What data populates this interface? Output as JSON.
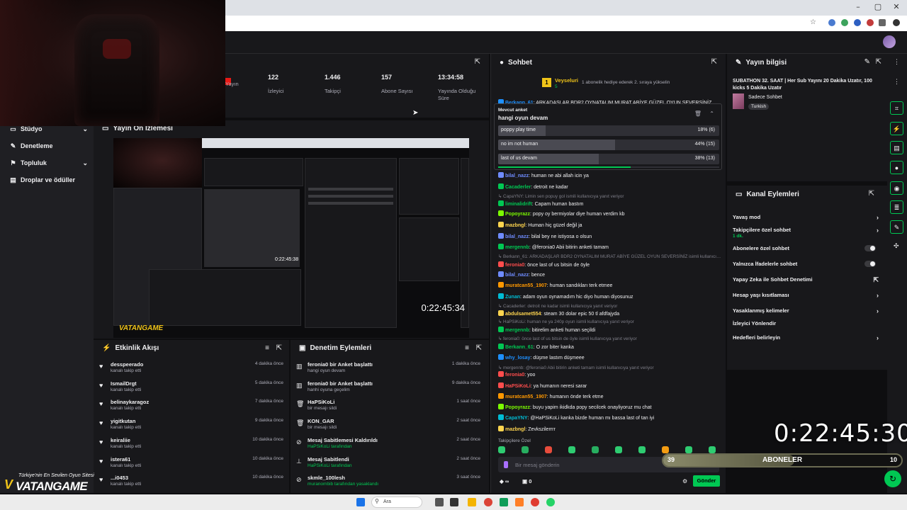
{
  "stats": [
    {
      "value": "",
      "label": "Yayın"
    },
    {
      "value": "122",
      "label": "İzleyici"
    },
    {
      "value": "1.446",
      "label": "Takipçi"
    },
    {
      "value": "157",
      "label": "Abone Sayısı"
    },
    {
      "value": "13:34:58",
      "label": "Yayında Olduğu Süre"
    }
  ],
  "nav": [
    {
      "label": "Stüdyo",
      "icon": "video-icon",
      "chev": "⌄"
    },
    {
      "label": "Denetleme",
      "icon": "wrench-icon",
      "chev": ""
    },
    {
      "label": "Topluluk",
      "icon": "group-icon",
      "chev": "⌄"
    },
    {
      "label": "Droplar ve ödüller",
      "icon": "gift-icon",
      "chev": ""
    }
  ],
  "preview": {
    "title": "Yayın Ön İzlemesi",
    "timer": "0:22:45:34",
    "small_timer": "0:22:45:38",
    "watermark": "VATANGAME"
  },
  "activity": {
    "title": "Etkinlik Akışı",
    "items": [
      {
        "name": "desspeerado",
        "sub": "kanalı takip etti",
        "time": "4 dakika önce"
      },
      {
        "name": "IsmailDrgt",
        "sub": "kanalı takip etti",
        "time": "5 dakika önce"
      },
      {
        "name": "belinaykaragoz",
        "sub": "kanalı takip etti",
        "time": "7 dakika önce"
      },
      {
        "name": "yigitkutan",
        "sub": "kanalı takip etti",
        "time": "9 dakika önce"
      },
      {
        "name": "keiraliie",
        "sub": "kanalı takip etti",
        "time": "10 dakika önce"
      },
      {
        "name": "istera61",
        "sub": "kanalı takip etti",
        "time": "10 dakika önce"
      },
      {
        "name": "...i0453",
        "sub": "kanalı takip etti",
        "time": "10 dakika önce"
      }
    ]
  },
  "modactions": {
    "title": "Denetim Eylemleri",
    "items": [
      {
        "name": "feronia0 bir Anket başlattı",
        "sub": "hangi oyun devam",
        "time": "1 dakika önce",
        "icon": "poll-icon"
      },
      {
        "name": "feronia0 bir Anket başlattı",
        "sub": "hanhi oyuna geçelim",
        "time": "9 dakika önce",
        "icon": "poll-icon"
      },
      {
        "name": "HaPSiKoLi",
        "sub": "bir mesajı sildi",
        "time": "1 saat önce",
        "icon": "trash-icon"
      },
      {
        "name": "KON_GAR",
        "sub": "bir mesajı sildi",
        "time": "2 saat önce",
        "icon": "trash-icon"
      },
      {
        "name": "Mesaj Sabitlemesi Kaldırıldı",
        "sub": "HaPSiKoLi tarafından",
        "time": "2 saat önce",
        "icon": "unpin-icon"
      },
      {
        "name": "Mesaj Sabitlendi",
        "sub": "HaPSiKoLi tarafından",
        "time": "2 saat önce",
        "icon": "pin-icon"
      },
      {
        "name": "skmle_100lesh",
        "sub": "muranombib tarafından yasaklandı",
        "time": "3 saat önce",
        "icon": "ban-icon"
      }
    ]
  },
  "chat": {
    "title": "Sohbet",
    "top_user": "Veyseluri",
    "top_user_count": "5",
    "gift_text": "1 abonelik hediye ederek 2. sıraya yükselin",
    "messages": [
      {
        "user": "Berkann_61",
        "text": ": ARKADAŞLAR BDR2 OYNATALIM MURAT ABİYE GÜZEL OYUN SEVERSİNİZ",
        "color": "#1e90ff",
        "reply": false
      },
      {
        "user": "bilal_nazz",
        "text": ": human ne abi allah icin ya",
        "color": "#6f8cff",
        "reply": false
      },
      {
        "user": "Cacaderler",
        "text": ": detroit ne kadar",
        "color": "#00c853",
        "reply": false
      },
      {
        "user": "",
        "text": "CapaYNY: Limin sen popuy gol ismili kullanıcıya yanıt veriyor",
        "color": "",
        "reply": true
      },
      {
        "user": "liminalidrift",
        "text": ": Capam human bastım",
        "color": "#00c853",
        "reply": false
      },
      {
        "user": "Popoyrazz",
        "text": ": popy oy bermiyolar diye human verdim kb",
        "color": "#7cfc00",
        "reply": false
      },
      {
        "user": "mazbngl",
        "text": ": Human hiç güzel değil ja",
        "color": "#ffd54f",
        "reply": false
      },
      {
        "user": "bilal_nazz",
        "text": ": bilal bey ne istiyosa o olsun",
        "color": "#6f8cff",
        "reply": false
      },
      {
        "user": "mergennb",
        "text": ": @feronia0 Abii bitirin anketi tamam",
        "color": "#00c853",
        "reply": false
      },
      {
        "user": "",
        "text": "Berkann_61: ARKADAŞLAR BDR2 OYNATALIM MURAT ABİYE GÜZEL OYUN SEVERSİNİZ isimli kullanıcıya...",
        "color": "",
        "reply": true
      },
      {
        "user": "feronia0",
        "text": ": önce last of us bitsin de öyle",
        "color": "#ff4d4d",
        "reply": false
      },
      {
        "user": "bilal_nazz",
        "text": ": bence",
        "color": "#6f8cff",
        "reply": false
      },
      {
        "user": "muratcan55_1907",
        "text": ": human sandıkları terk etmee",
        "color": "#ff9800",
        "reply": false
      },
      {
        "user": "Zunan",
        "text": ": adam oyun oynamadım hic diyo human diyosunuz",
        "color": "#00bcd4",
        "reply": false
      },
      {
        "user": "",
        "text": "Cacaderler: detroit ne kadar isimli kullanıcıya yanıt veriyor",
        "color": "",
        "reply": true
      },
      {
        "user": "abdulsamet554",
        "text": ": steam 30 dolar epic 50 tl afdfajyda",
        "color": "#ffd54f",
        "reply": false
      },
      {
        "user": "",
        "text": "HaPSiKoLi: human ne ya 240p oyun isimli kullanıcıya yanıt veriyor",
        "color": "",
        "reply": true
      },
      {
        "user": "mergennb",
        "text": ": bitirelim anketi human seçildi",
        "color": "#00c853",
        "reply": false
      },
      {
        "user": "",
        "text": "feronia0: önce last of us bitsin de öyle isimli kullanıcıya yanıt veriyor",
        "color": "",
        "reply": true
      },
      {
        "user": "Berkann_61",
        "text": ": O zor biter kanka",
        "color": "#00c853",
        "reply": false
      },
      {
        "user": "why_losay",
        "text": ": düşme lastım düşmeee",
        "color": "#1e90ff",
        "reply": false
      },
      {
        "user": "",
        "text": "mergennb: @feronia0 Abii bitirin anketi tamam isimli kullanıcıya yanıt veriyor",
        "color": "",
        "reply": true
      },
      {
        "user": "feronia0",
        "text": ": yoo",
        "color": "#ff4d4d",
        "reply": false
      },
      {
        "user": "HaPSiKoLi",
        "text": ": ya humanın neresi sarar",
        "color": "#ff4d4d",
        "reply": false
      },
      {
        "user": "muratcan55_1907",
        "text": ": humanın önde terk etme",
        "color": "#ff9800",
        "reply": false
      },
      {
        "user": "Popoyrazz",
        "text": ": buyu yapim ikidkda popy secilcek onayliyoruz mu chat",
        "color": "#7cfc00",
        "reply": false
      },
      {
        "user": "CapaYNY",
        "text": ": @HaPSiKoLi kanka bizde human mı bassa last of tan iyi",
        "color": "#00bcd4",
        "reply": false
      },
      {
        "user": "mazbngl",
        "text": ": Zevkszilerrrr",
        "color": "#ffd54f",
        "reply": false
      }
    ],
    "followers_only": "Takipçilere Özel",
    "placeholder": "Bir mesaj gönderin",
    "send": "Gönder",
    "points": "∞",
    "box_count": "0"
  },
  "poll": {
    "label": "Mevcut anket",
    "question": "hangi oyun devam",
    "options": [
      {
        "text": "poppy play time",
        "result": "18% (6)",
        "pct": 0.18
      },
      {
        "text": "no im not human",
        "result": "44% (15)",
        "pct": 0.44
      },
      {
        "text": "last of us devam",
        "result": "38% (13)",
        "pct": 0.38
      }
    ],
    "progress": 0.6
  },
  "streaminfo": {
    "title": "Yayın bilgisi",
    "stream_title": "SUBATHON 32. SAAT | Her Sub Yayını 20 Dakika Uzatır, 100 kicks 5 Dakika Uzatır",
    "category": "Sadece Sohbet",
    "tag": "Turkish"
  },
  "channel_actions": {
    "title": "Kanal Eylemleri",
    "rows": [
      {
        "label": "Yavaş mod",
        "sub": "",
        "ctrl": "chev"
      },
      {
        "label": "Takipçilere özel sohbet",
        "sub": "1 dk.",
        "ctrl": "chev"
      },
      {
        "label": "Abonelere özel sohbet",
        "sub": "",
        "ctrl": "toggle"
      },
      {
        "label": "Yalnızca İfadelerle sohbet",
        "sub": "",
        "ctrl": "toggle"
      },
      {
        "label": "Yapay Zeka ile Sohbet Denetimi",
        "sub": "",
        "ctrl": "ext"
      },
      {
        "label": "Hesap yaşı kısıtlaması",
        "sub": "",
        "ctrl": "chev"
      },
      {
        "label": "Yasaklanmış kelimeler",
        "sub": "",
        "ctrl": "chev"
      },
      {
        "label": "İzleyici Yönlendir",
        "sub": "",
        "ctrl": ""
      },
      {
        "label": "Hedefleri belirleyin",
        "sub": "",
        "ctrl": "chev"
      }
    ]
  },
  "overlay": {
    "timer": "0:22:45:30",
    "sub_label": "ABONELER",
    "sub_current": "39",
    "sub_goal": "10",
    "sub_progress": 0.55,
    "tagline": "Türkiye'nin En Sevilen Oyun Sitesi",
    "brand": "VATANGAME"
  },
  "taskbar": {
    "search": "Ara"
  },
  "colors": {
    "accent": "#00c853",
    "bg": "#18181b",
    "page": "#0e0e10"
  }
}
